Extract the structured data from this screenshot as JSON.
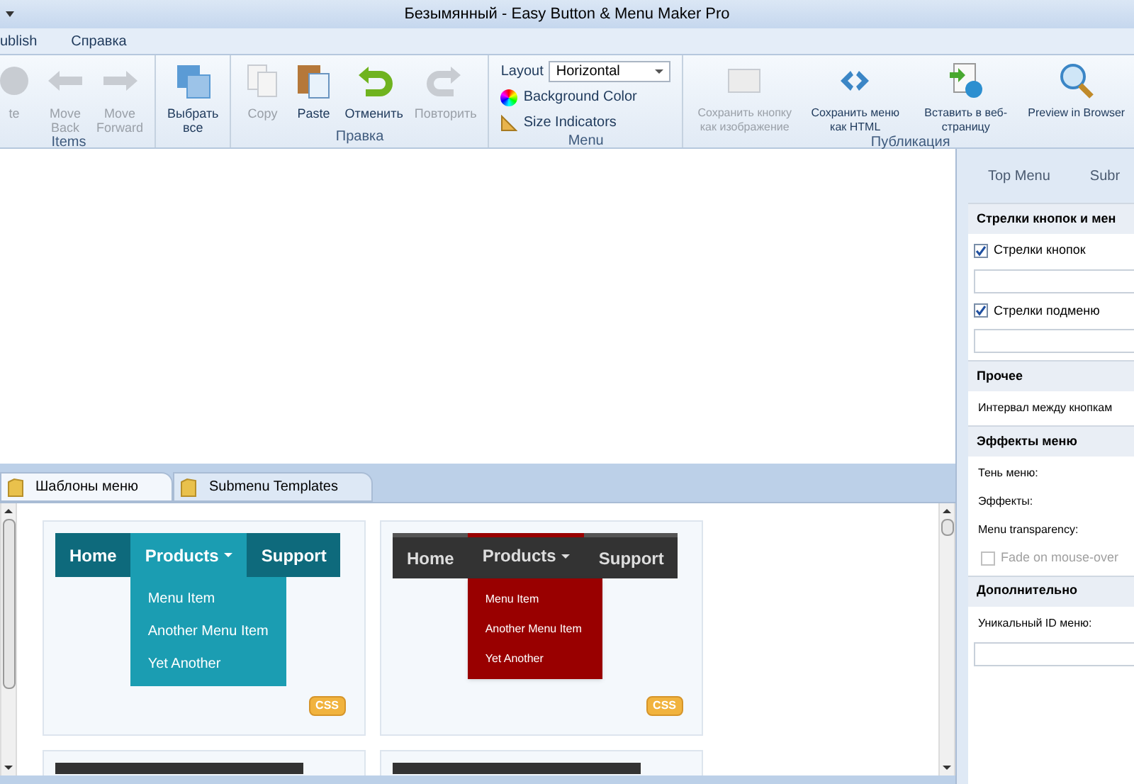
{
  "window": {
    "title": "Безымянный - Easy Button & Menu Maker Pro"
  },
  "menu_bar": [
    "ublish",
    "Справка"
  ],
  "ribbon": [
    {
      "label": "Items",
      "buttons": [
        {
          "label": "te",
          "disabled": true
        },
        {
          "label": "Move Back",
          "disabled": true
        },
        {
          "label": "Move Forward",
          "disabled": true
        }
      ]
    },
    {
      "buttons": [
        {
          "label": "Выбрать все",
          "disabled": false
        }
      ]
    },
    {
      "label": "Правка",
      "buttons": [
        {
          "label": "Copy",
          "disabled": true
        },
        {
          "label": "Paste",
          "disabled": false
        },
        {
          "label": "Отменить",
          "disabled": false
        },
        {
          "label": "Повторить",
          "disabled": true
        }
      ]
    },
    {
      "label": "Menu",
      "layout": {
        "label": "Layout",
        "value": "Horizontal"
      },
      "options": [
        "Background Color",
        "Size Indicators"
      ]
    },
    {
      "label": "Публикация",
      "buttons": [
        {
          "label": "Сохранить кнопку как изображение",
          "disabled": true
        },
        {
          "label": "Сохранить меню как HTML",
          "disabled": false
        },
        {
          "label": "Вставить в веб-страницу",
          "disabled": false
        },
        {
          "label": "Preview in Browser",
          "disabled": false
        }
      ]
    }
  ],
  "template_tabs": [
    {
      "label": "Шаблоны меню",
      "selected": true
    },
    {
      "label": "Submenu Templates",
      "selected": false
    }
  ],
  "templates": [
    {
      "kind": "teal",
      "items": [
        {
          "label": "Home",
          "selected": false
        },
        {
          "label": "Products",
          "selected": true
        },
        {
          "label": "Support",
          "selected": false
        }
      ],
      "submenu": [
        "Menu Item",
        "Another Menu Item",
        "Yet Another"
      ],
      "badge": "CSS"
    },
    {
      "kind": "dark",
      "items": [
        {
          "label": "Home",
          "selected": false
        },
        {
          "label": "Products",
          "selected": true
        },
        {
          "label": "Support",
          "selected": false
        }
      ],
      "submenu": [
        "Menu Item",
        "Another Menu Item",
        "Yet Another"
      ],
      "badge": "CSS"
    }
  ],
  "properties": {
    "tabs": [
      {
        "label": "Top Menu",
        "selected": false
      },
      {
        "label": "Subr",
        "selected": false
      }
    ],
    "sections": [
      {
        "title": "Стрелки кнопок и мен",
        "rows": [
          {
            "kind": "checkbox",
            "label": "Стрелки кнопок",
            "checked": true,
            "disabled": false
          },
          {
            "kind": "field"
          },
          {
            "kind": "checkbox",
            "label": "Стрелки подменю",
            "checked": true,
            "disabled": false
          },
          {
            "kind": "field"
          }
        ]
      },
      {
        "title": "Прочее",
        "rows": [
          {
            "kind": "text",
            "label": "Интервал между кнопкам"
          }
        ]
      },
      {
        "title": "Эффекты меню",
        "rows": [
          {
            "kind": "text",
            "label": "Тень меню:"
          },
          {
            "kind": "text",
            "label": "Эффекты:"
          },
          {
            "kind": "text",
            "label": "Menu transparency:"
          },
          {
            "kind": "checkbox",
            "label": "Fade on mouse-over",
            "checked": false,
            "disabled": true
          }
        ]
      },
      {
        "title": "Дополнительно",
        "rows": [
          {
            "kind": "text",
            "label": "Уникальный ID меню:"
          },
          {
            "kind": "field"
          }
        ]
      }
    ]
  }
}
